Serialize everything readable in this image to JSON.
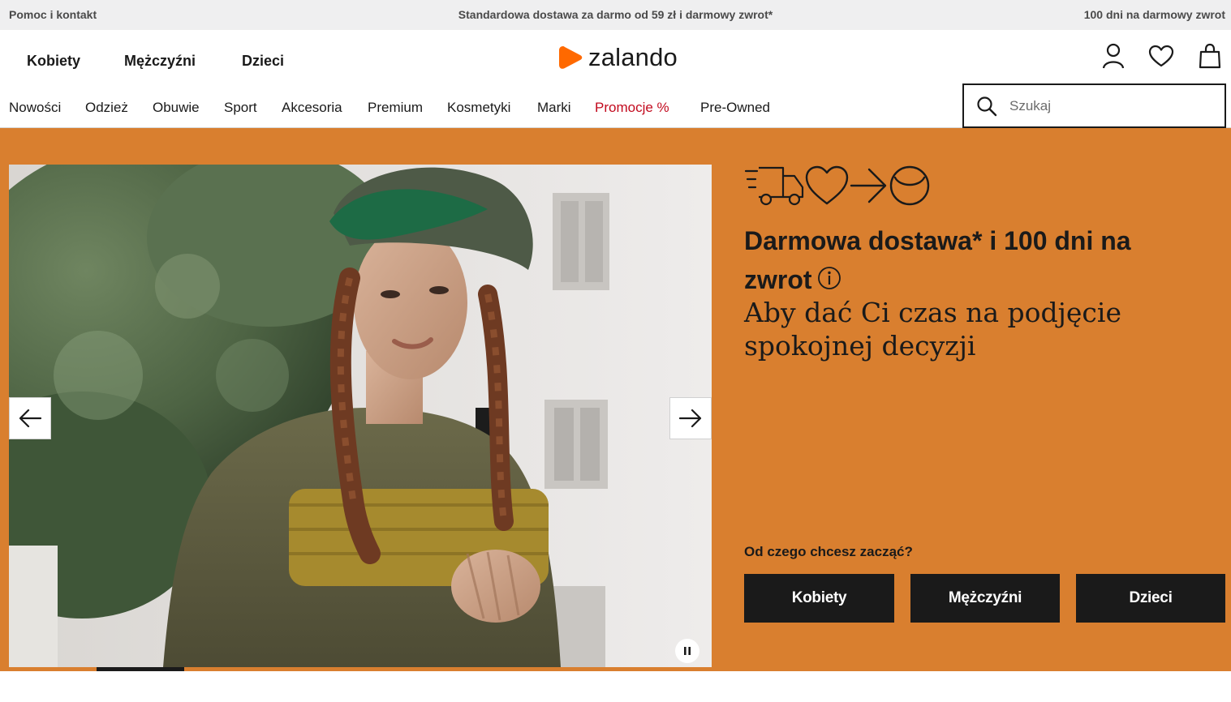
{
  "topbar": {
    "left": "Pomoc i kontakt",
    "center": "Standardowa dostawa za darmo od 59 zł i darmowy zwrot*",
    "right": "100 dni na darmowy zwrot"
  },
  "header": {
    "gender_tabs": [
      "Kobiety",
      "Mężczyźni",
      "Dzieci"
    ],
    "logo": "zalando",
    "icons": [
      "user-icon",
      "heart-icon",
      "bag-icon"
    ],
    "nav_items": [
      "Nowości",
      "Odzież",
      "Obuwie",
      "Sport",
      "Akcesoria",
      "Premium",
      "Kosmetyki",
      "Marki",
      "Promocje %",
      "Pre-Owned"
    ],
    "search_placeholder": "Szukaj"
  },
  "colors": {
    "brand_orange": "#ff6900",
    "hero_background": "#d97f2f",
    "promo_link": "#c20a1e",
    "dark": "#1a1a1a",
    "topbar": "#efeff0"
  },
  "hero": {
    "promo_icons": [
      "truck-icon",
      "heart-icon",
      "arrow-right-icon",
      "smile-icon"
    ],
    "headline": "Darmowa dostawa* i 100 dni na zwrot",
    "subline": "Aby dać Ci czas na podjęcie spokojnej decyzji",
    "question": "Od czego chcesz zacząć?",
    "buttons": [
      "Kobiety",
      "Mężczyźni",
      "Dzieci"
    ],
    "carousel_progress": 0.25
  }
}
